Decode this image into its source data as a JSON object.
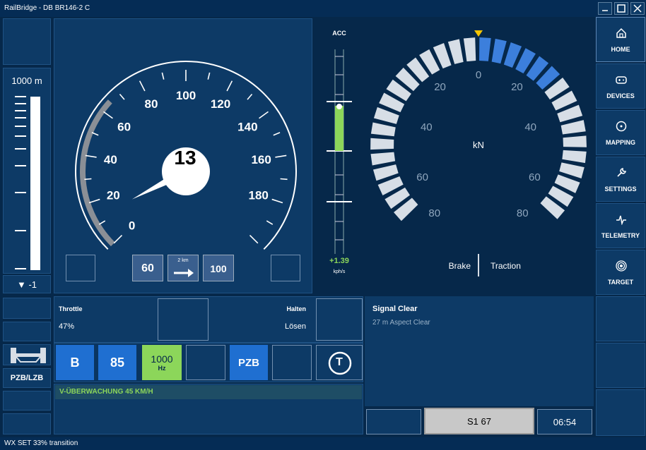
{
  "window": {
    "title": "RailBridge - DB BR146-2 C"
  },
  "status_bar": {
    "text": "WX SET 33% transition"
  },
  "distance": {
    "label": "1000 m",
    "direction": "▼ -1"
  },
  "speedometer": {
    "current_speed": "13",
    "tick_labels": [
      "0",
      "20",
      "40",
      "60",
      "80",
      "100",
      "120",
      "140",
      "160",
      "180"
    ],
    "ticks_values": [
      0,
      20,
      40,
      60,
      80,
      100,
      120,
      140,
      160,
      180
    ],
    "needle_speed": 13,
    "max_speed": 200,
    "limit_arc": [
      0,
      65
    ]
  },
  "speed_indicators": {
    "current_limit": "60",
    "distance_label": "2 km",
    "next_limit": "100"
  },
  "acceleration": {
    "label": "ACC",
    "value": "+1.39",
    "unit": "kph/s",
    "level": 0.55
  },
  "force_gauge": {
    "unit_label": "kN",
    "brake_label": "Brake",
    "traction_label": "Traction",
    "left_ticks": [
      "20",
      "40",
      "60",
      "80"
    ],
    "right_ticks": [
      "20",
      "40",
      "60",
      "80"
    ],
    "zero_label": "0",
    "traction_segments_active": 6,
    "total_segments_per_side": 16
  },
  "controls": {
    "throttle_label": "Throttle",
    "throttle_value": "47%",
    "brake_label": "Halten",
    "brake_value": "Lösen"
  },
  "signal": {
    "title": "Signal Clear",
    "subtitle": "27 m Aspect Clear"
  },
  "pzb": {
    "b_label": "B",
    "speed_label": "85",
    "freq_label": "1000",
    "freq_unit": "Hz",
    "pzb_label": "PZB",
    "t_label": "T",
    "system_label": "PZB/LZB"
  },
  "message": {
    "text": "V-ÜBERWACHUNG 45 KM/H"
  },
  "footer": {
    "route": "S1 67",
    "time": "06:54"
  },
  "nav": [
    {
      "label": "HOME",
      "icon": "home-icon"
    },
    {
      "label": "DEVICES",
      "icon": "gamepad-icon"
    },
    {
      "label": "MAPPING",
      "icon": "target-circle-icon"
    },
    {
      "label": "SETTINGS",
      "icon": "wrench-icon"
    },
    {
      "label": "TELEMETRY",
      "icon": "pulse-icon"
    },
    {
      "label": "TARGET",
      "icon": "bullseye-icon"
    }
  ],
  "colors": {
    "background": "#06284a",
    "panel": "#0d3a66",
    "accent_blue": "#3c7fdc",
    "accent_green": "#8cd65a",
    "segment_inactive": "#d7dee6"
  }
}
